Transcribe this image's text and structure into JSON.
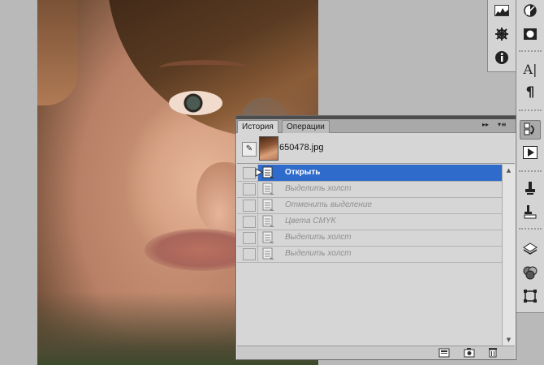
{
  "panel": {
    "tabs": [
      {
        "label": "История",
        "active": true
      },
      {
        "label": "Операции",
        "active": false
      }
    ],
    "snapshot": {
      "name": "650478.jpg"
    },
    "history": [
      {
        "label": "Открыть",
        "selected": true
      },
      {
        "label": "Выделить холст",
        "selected": false
      },
      {
        "label": "Отменить выделение",
        "selected": false
      },
      {
        "label": "Цвета CMYK",
        "selected": false
      },
      {
        "label": "Выделить холст",
        "selected": false
      },
      {
        "label": "Выделить холст",
        "selected": false
      }
    ],
    "footer_buttons": [
      "new-document-from-state-icon",
      "create-snapshot-icon",
      "trash-icon"
    ],
    "controls": {
      "forward": "▸▸",
      "menu": "▾≡"
    }
  },
  "right_strip_a": [
    "histogram-icon",
    "navigator-wheel-icon",
    "info-icon"
  ],
  "right_strip_b": [
    "adjustments-icon",
    "mask-icon",
    "character-icon",
    "paragraph-icon",
    "history-icon",
    "actions-play-icon",
    "clone-source-icon",
    "tool-presets-icon",
    "layers-icon",
    "channels-icon",
    "paths-icon"
  ],
  "glyphs": {
    "character": "A|",
    "paragraph": "¶",
    "info": "i"
  },
  "colors": {
    "selection": "#2f6bcb",
    "panel_bg": "#d6d6d6",
    "app_bg": "#b9b9b9"
  }
}
